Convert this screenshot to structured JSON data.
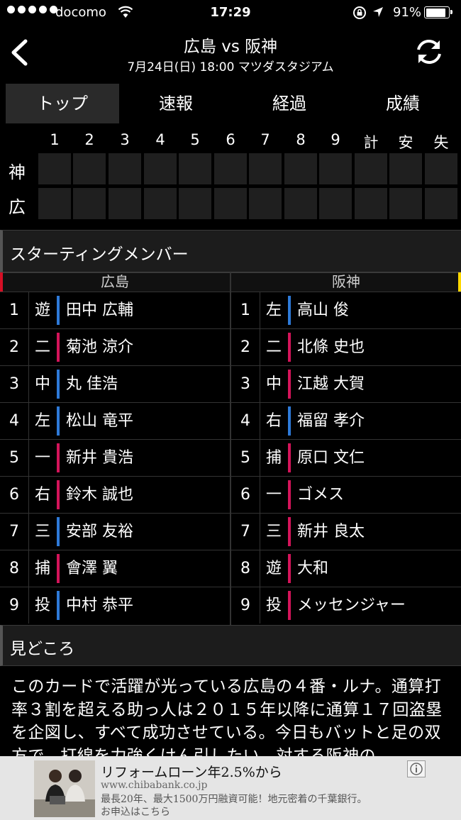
{
  "status": {
    "carrier": "docomo",
    "time": "17:29",
    "battery": "91%"
  },
  "header": {
    "title": "広島 vs 阪神",
    "subtitle": "7月24日(日) 18:00 マツダスタジアム"
  },
  "tabs": [
    "トップ",
    "速報",
    "経過",
    "成績"
  ],
  "scoreboard": {
    "columns": [
      "1",
      "2",
      "3",
      "4",
      "5",
      "6",
      "7",
      "8",
      "9",
      "計",
      "安",
      "失"
    ],
    "teams": [
      "神",
      "広"
    ]
  },
  "starting": {
    "title": "スターティングメンバー",
    "home_team": "広島",
    "away_team": "阪神",
    "home": [
      {
        "order": "1",
        "pos": "遊",
        "name": "田中 広輔",
        "bats": "L"
      },
      {
        "order": "2",
        "pos": "二",
        "name": "菊池 涼介",
        "bats": "R"
      },
      {
        "order": "3",
        "pos": "中",
        "name": "丸 佳浩",
        "bats": "L"
      },
      {
        "order": "4",
        "pos": "左",
        "name": "松山 竜平",
        "bats": "L"
      },
      {
        "order": "5",
        "pos": "一",
        "name": "新井 貴浩",
        "bats": "R"
      },
      {
        "order": "6",
        "pos": "右",
        "name": "鈴木 誠也",
        "bats": "R"
      },
      {
        "order": "7",
        "pos": "三",
        "name": "安部 友裕",
        "bats": "L"
      },
      {
        "order": "8",
        "pos": "捕",
        "name": "會澤 翼",
        "bats": "R"
      },
      {
        "order": "9",
        "pos": "投",
        "name": "中村 恭平",
        "bats": "L"
      }
    ],
    "away": [
      {
        "order": "1",
        "pos": "左",
        "name": "高山 俊",
        "bats": "L"
      },
      {
        "order": "2",
        "pos": "二",
        "name": "北條 史也",
        "bats": "R"
      },
      {
        "order": "3",
        "pos": "中",
        "name": "江越 大賀",
        "bats": "R"
      },
      {
        "order": "4",
        "pos": "右",
        "name": "福留 孝介",
        "bats": "L"
      },
      {
        "order": "5",
        "pos": "捕",
        "name": "原口 文仁",
        "bats": "R"
      },
      {
        "order": "6",
        "pos": "一",
        "name": "ゴメス",
        "bats": "R"
      },
      {
        "order": "7",
        "pos": "三",
        "name": "新井 良太",
        "bats": "R"
      },
      {
        "order": "8",
        "pos": "遊",
        "name": "大和",
        "bats": "R"
      },
      {
        "order": "9",
        "pos": "投",
        "name": "メッセンジャー",
        "bats": "R"
      }
    ]
  },
  "highlights": {
    "title": "見どころ",
    "text": "このカードで活躍が光っている広島の４番・ルナ。通算打率３割を超える助っ人は２０１５年以降に通算１７回盗塁を企図し、すべて成功させている。今日もバットと足の双方で、打線を力強くけん引したい。対する阪神の"
  },
  "ad": {
    "title": "リフォームローン年2.5%から",
    "url": "www.chibabank.co.jp",
    "desc": "最長20年、最大1500万円融資可能！地元密着の千葉銀行。",
    "cta": "お申込はこちら"
  },
  "colors": {
    "left_bat": "#2e7ad8",
    "right_bat": "#d4145a",
    "home_accent": "#d50f25",
    "away_accent": "#ffd800"
  }
}
